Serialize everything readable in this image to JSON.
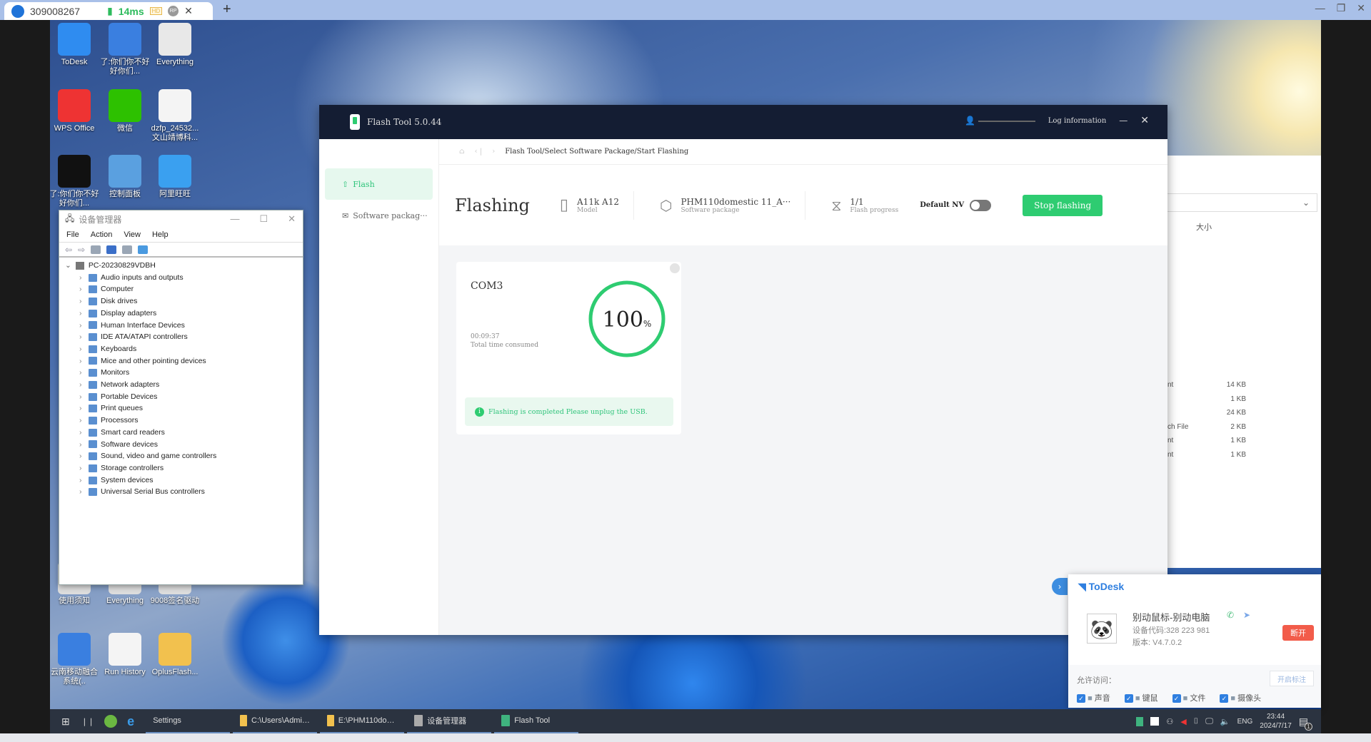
{
  "remote_tab": {
    "id": "309008267",
    "latency": "14ms",
    "hd_badge": "HD",
    "rp_badge": "RP"
  },
  "desktop_icons": [
    {
      "label": "ToDesk",
      "color": "#2f8cf0"
    },
    {
      "label": "了:你们你不好好你们...",
      "color": "#3a7fe0"
    },
    {
      "label": "Everything",
      "color": "#e8e8e8"
    },
    {
      "label": "WPS Office",
      "color": "#e33"
    },
    {
      "label": "微信",
      "color": "#2dc100"
    },
    {
      "label": "dzfp_24532... 文山靖博科...",
      "color": "#f4f4f4"
    },
    {
      "label": "了:你们你不好好你们...",
      "color": "#111"
    },
    {
      "label": "控制面板",
      "color": "#5aa0e0"
    },
    {
      "label": "阿里旺旺",
      "color": "#3aa0f0"
    },
    {
      "label": "使用须知",
      "color": "#ddd"
    },
    {
      "label": "Everything",
      "color": "#ddd"
    },
    {
      "label": "9008签名驱动",
      "color": "#ddd"
    },
    {
      "label": "云南移动融合系统(..",
      "color": "#3a7fe0"
    },
    {
      "label": "Run History",
      "color": "#f4f4f4"
    },
    {
      "label": "OplusFlash...",
      "color": "#f2c14e"
    }
  ],
  "device_manager": {
    "title": "设备管理器",
    "menu": [
      "File",
      "Action",
      "View",
      "Help"
    ],
    "root": "PC-20230829VDBH",
    "items": [
      "Audio inputs and outputs",
      "Computer",
      "Disk drives",
      "Display adapters",
      "Human Interface Devices",
      "IDE ATA/ATAPI controllers",
      "Keyboards",
      "Mice and other pointing devices",
      "Monitors",
      "Network adapters",
      "Portable Devices",
      "Print queues",
      "Processors",
      "Smart card readers",
      "Software devices",
      "Sound, video and game controllers",
      "Storage controllers",
      "System devices",
      "Universal Serial Bus controllers"
    ]
  },
  "explorer": {
    "size_header": "大小",
    "rows": [
      {
        "type": "nt",
        "size": "14 KB"
      },
      {
        "type": "",
        "size": "1 KB"
      },
      {
        "type": "",
        "size": "24 KB"
      },
      {
        "type": "ch File",
        "size": "2 KB"
      },
      {
        "type": "nt",
        "size": "1 KB"
      },
      {
        "type": "nt",
        "size": "1 KB"
      }
    ]
  },
  "flash_tool": {
    "title": "Flash Tool 5.0.44",
    "log_info": "Log information",
    "sidebar": [
      {
        "label": "Flash",
        "active": true
      },
      {
        "label": "Software packag···"
      }
    ],
    "breadcrumb": "Flash Tool/Select Software Package/Start Flashing",
    "heading": "Flashing",
    "model": {
      "value": "A11k A12",
      "label": "Model"
    },
    "package": {
      "value": "PHM110domestic 11_A···",
      "label": "Software package"
    },
    "progress": {
      "value": "1/1",
      "label": "Flash progress"
    },
    "default_nv": {
      "label": "Default NV",
      "on": false
    },
    "stop_button": "Stop flashing",
    "accent": "#2ecc71",
    "card": {
      "port": "COM3",
      "percent": "100",
      "percent_sign": "%",
      "percent_value": 100,
      "time": "00:09:37",
      "time_label": "Total time consumed",
      "message": "Flashing is completed  Please unplug the USB."
    }
  },
  "todesk": {
    "brand": "ToDesk",
    "name": "别动鼠标-别动电脑",
    "device_code": "设备代码:328 223 981",
    "version": "版本: V4.7.0.2",
    "disconnect": "断开",
    "allow_label": "允许访问：",
    "annotate": "开启标注",
    "perms": [
      "声音",
      "键鼠",
      "文件",
      "摄像头"
    ]
  },
  "taskbar": {
    "items": [
      "Settings",
      "C:\\Users\\Administr...",
      "E:\\PHM110domesti...",
      "设备管理器",
      "Flash Tool"
    ],
    "lang": "ENG",
    "time": "23:44",
    "date": "2024/7/17",
    "notif_count": "1"
  }
}
